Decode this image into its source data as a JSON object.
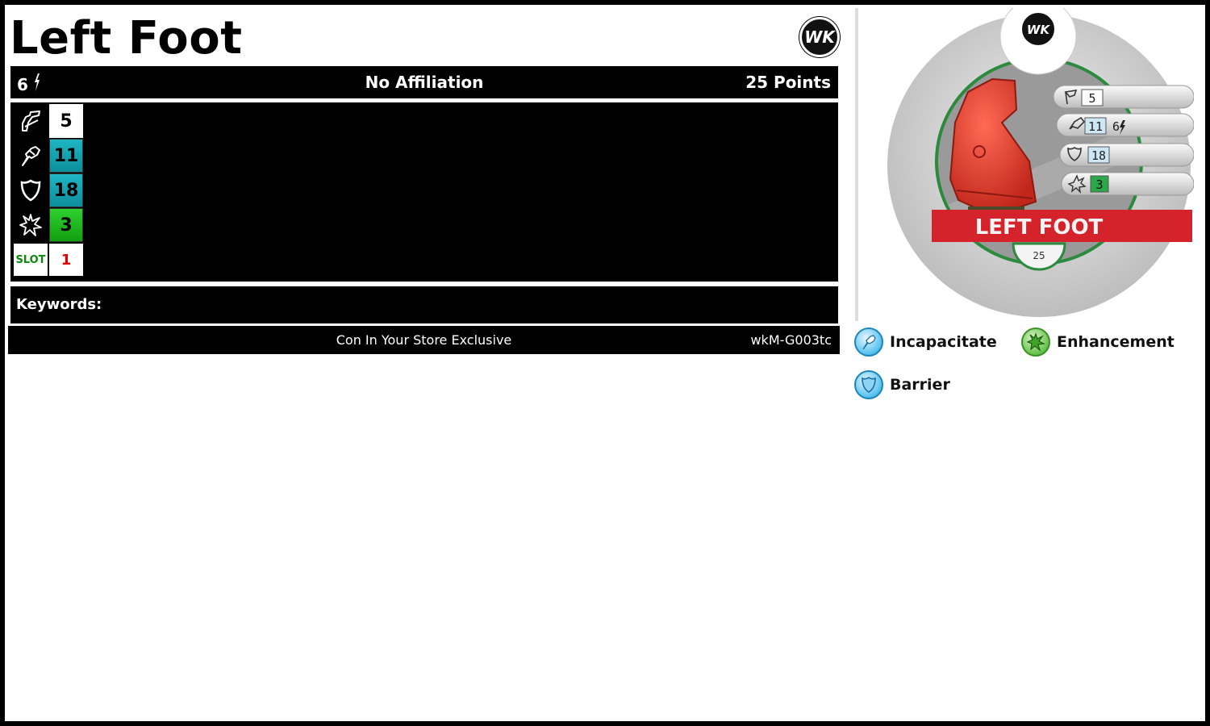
{
  "character": {
    "name": "Left Foot",
    "range": "6",
    "affiliation": "No Affiliation",
    "points": "25 Points"
  },
  "stats": {
    "speed": "5",
    "attack": "11",
    "defense": "18",
    "damage": "3",
    "slot_label": "SLOT",
    "slot_value": "1"
  },
  "keywords_label": "Keywords:",
  "footer": {
    "edition": "Con In Your Store Exclusive",
    "code": "wkM-G003tc"
  },
  "logo_text": "WK",
  "dial": {
    "name": "LEFT FOOT",
    "points": "25",
    "speed": "5",
    "attack": "11",
    "range": "6",
    "defense": "18",
    "damage": "3"
  },
  "powers": [
    {
      "name": "Incapacitate",
      "color": "blue",
      "icon": "fist-icon"
    },
    {
      "name": "Enhancement",
      "color": "green",
      "icon": "burst-icon"
    },
    {
      "name": "Barrier",
      "color": "blue",
      "icon": "shield-icon"
    }
  ],
  "colors": {
    "teal": "#1fb6c4",
    "green": "#2fd02f",
    "slot_text": "#0a8a0a",
    "slot_value": "#e00000",
    "dial_red": "#d4232a"
  }
}
